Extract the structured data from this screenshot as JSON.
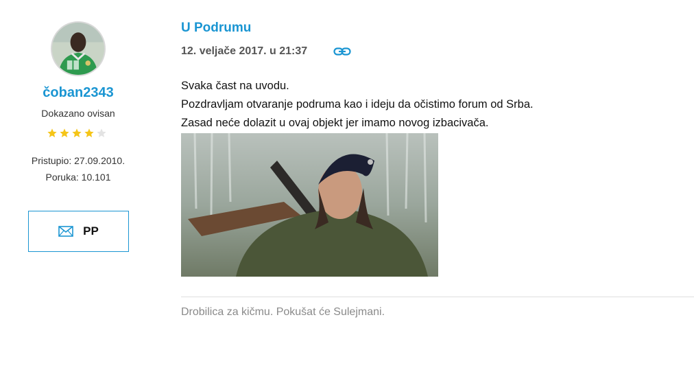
{
  "author": {
    "avatar_icon": "avatar-player-photo",
    "username": "čoban2343",
    "rank": "Dokazano ovisan",
    "rating": {
      "filled": 4,
      "total": 5
    },
    "joined": "Pristupio: 27.09.2010.",
    "posts": "Poruka: 10.101",
    "pm_label": "PP",
    "pm_icon": "envelope-icon"
  },
  "post": {
    "topic_title": "U Podrumu",
    "date": "12. veljače 2017. u 21:37",
    "permalink_icon": "link-icon",
    "body_lines": [
      "Svaka čast na uvodu.",
      "Pozdravljam otvaranje podruma kao i ideju da očistimo forum od Srba.",
      "Zasad neće dolazit u ovaj objekt jer imamo novog izbacivača."
    ],
    "image_icon": "soldier-photo",
    "signature": "Drobilica za kičmu. Pokušat će Sulejmani."
  },
  "colors": {
    "accent": "#1a95d2",
    "star_filled": "#f5c518",
    "star_empty": "#e3e3e3",
    "muted_text": "#8a8a8a"
  }
}
